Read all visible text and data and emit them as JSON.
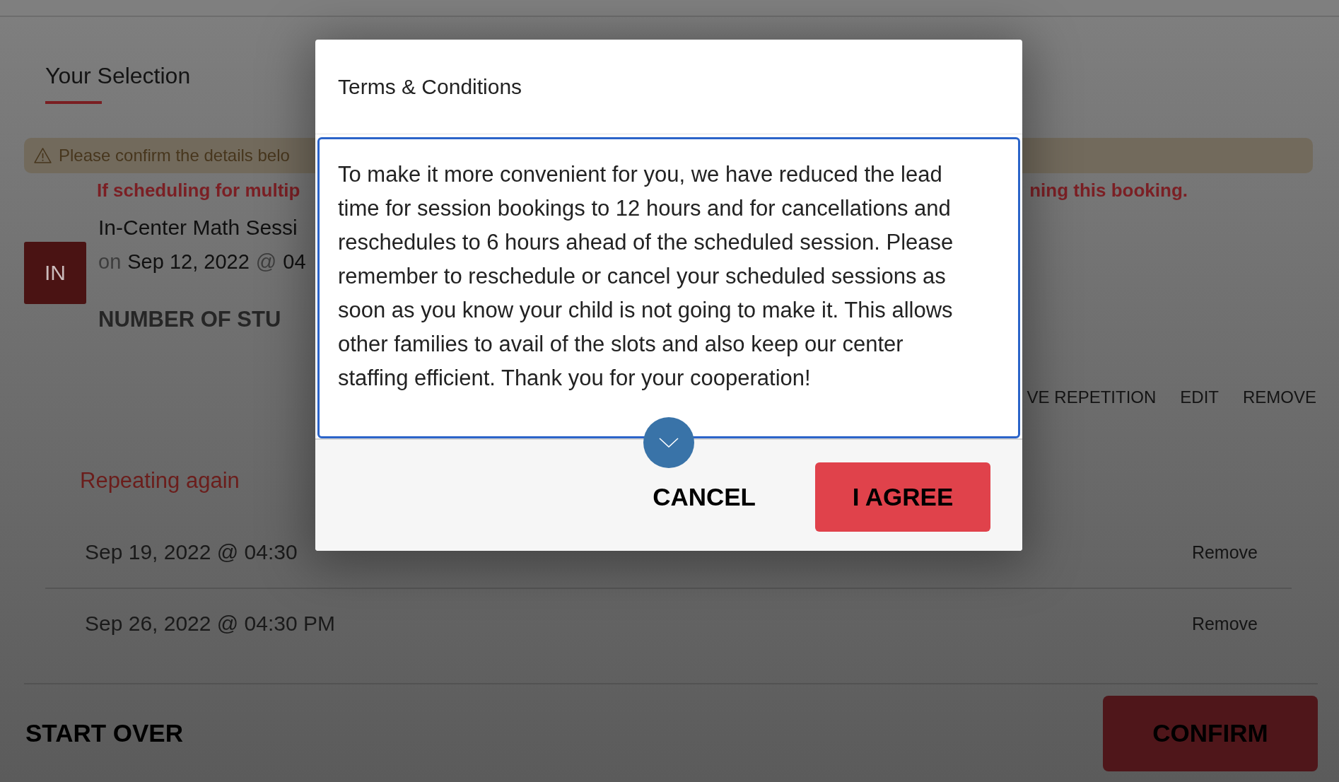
{
  "tabs": [
    {
      "label": "Your Selection",
      "selected": true
    }
  ],
  "warning_banner": {
    "text": "Please confirm the details belo"
  },
  "notice": {
    "left_text": "If scheduling for multip",
    "right_text": "ning this booking."
  },
  "session": {
    "badge": "IN",
    "title": "In-Center Math Sessi",
    "date_prefix": "on",
    "date": "Sep 12, 2022",
    "at": "@",
    "time": "04",
    "students_label": "NUMBER OF STU"
  },
  "session_actions": [
    "VE REPETITION",
    "EDIT",
    "REMOVE"
  ],
  "repeats": {
    "heading": "Repeating again",
    "rows": [
      {
        "date": "Sep 19, 2022 @ 04:30",
        "action": "Remove"
      },
      {
        "date": "Sep 26, 2022 @ 04:30 PM",
        "action": "Remove"
      }
    ]
  },
  "footer": {
    "start_over": "START OVER",
    "confirm": "CONFIRM"
  },
  "modal": {
    "title": "Terms & Conditions",
    "body": "To make it more convenient for you, we have reduced the lead time for session bookings to 12 hours and for cancellations and reschedules to 6 hours ahead of the scheduled session. Please remember to reschedule or cancel your scheduled sessions as soon as you know your child is not going to make it. This allows other families to avail of the slots and also keep our center staffing efficient. Thank you for your cooperation!",
    "buttons": [
      {
        "label": "CANCEL",
        "kind": "secondary"
      },
      {
        "label": "I AGREE",
        "kind": "primary"
      }
    ]
  }
}
